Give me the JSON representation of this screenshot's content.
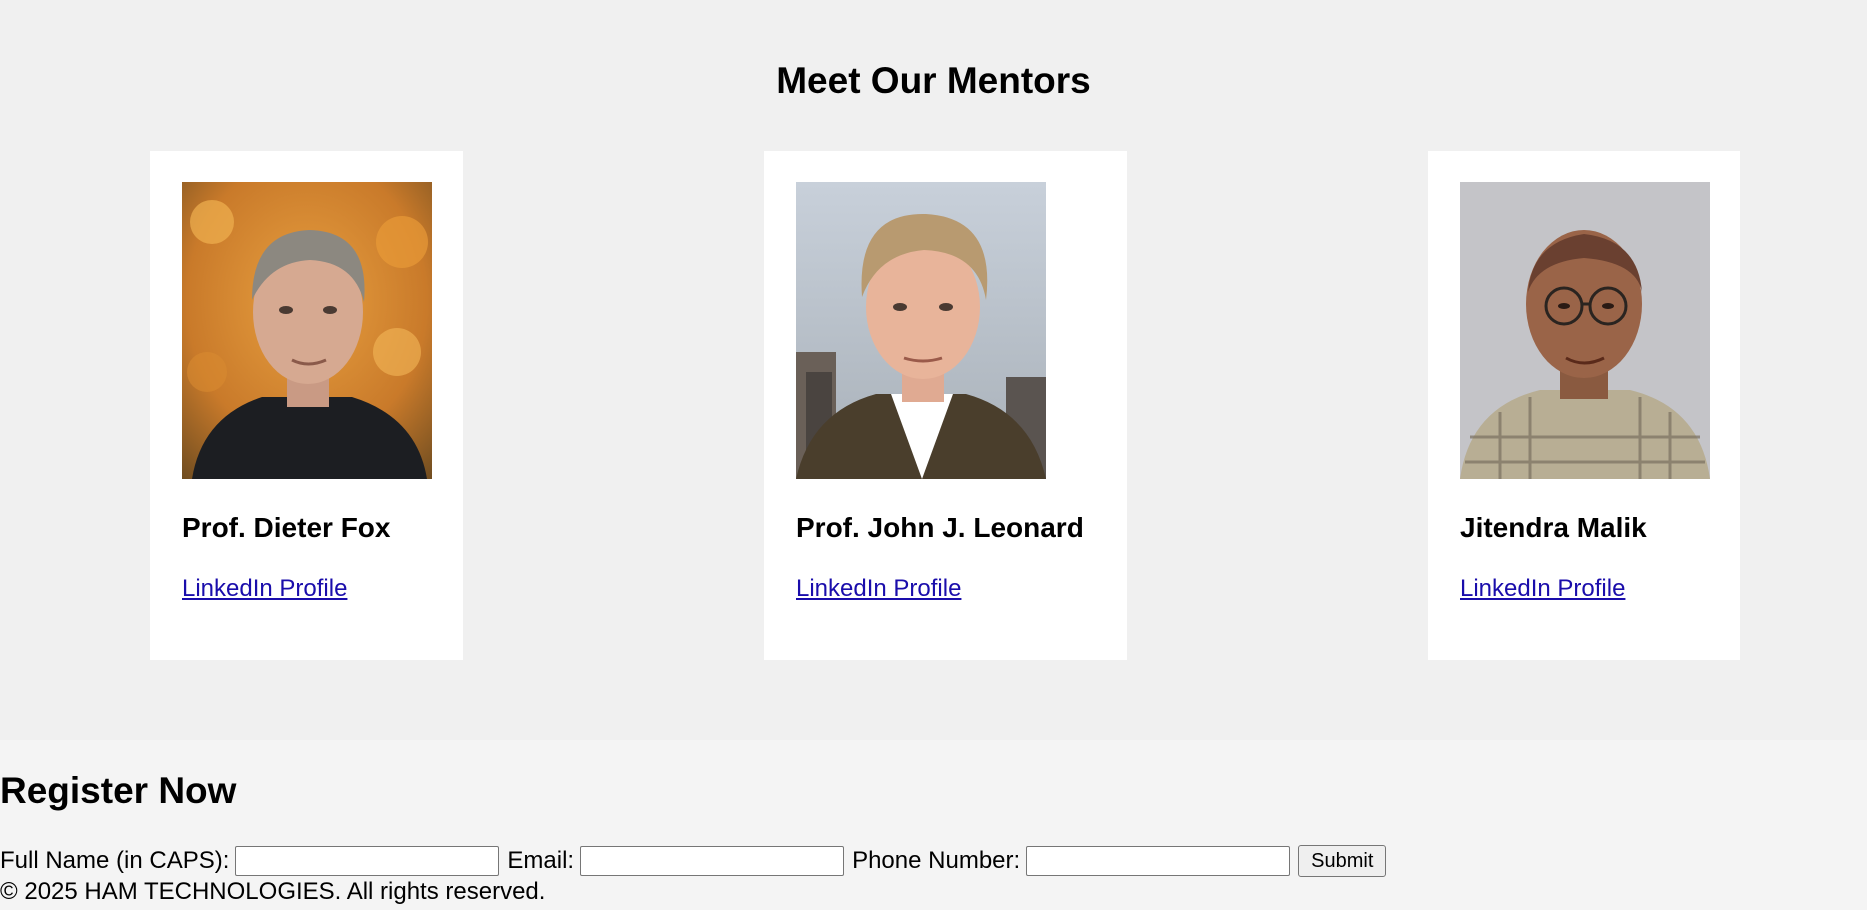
{
  "mentors_section": {
    "title": "Meet Our Mentors",
    "mentors": [
      {
        "name": "Prof. Dieter Fox",
        "link_label": "LinkedIn Profile",
        "photo": "portrait-photo"
      },
      {
        "name": "Prof. John J. Leonard",
        "link_label": "LinkedIn Profile",
        "photo": "portrait-photo"
      },
      {
        "name": "Jitendra Malik",
        "link_label": "LinkedIn Profile",
        "photo": "portrait-photo"
      }
    ]
  },
  "register": {
    "title": "Register Now",
    "full_name_label": "Full Name (in CAPS):",
    "full_name_value": "",
    "email_label": "Email:",
    "email_value": "",
    "phone_label": "Phone Number:",
    "phone_value": "",
    "submit_label": "Submit"
  },
  "footer": {
    "text": "© 2025 HAM TECHNOLOGIES. All rights reserved."
  },
  "colors": {
    "link": "#1a0dab",
    "section_bg": "#f0f0f0",
    "card_bg": "#ffffff"
  }
}
